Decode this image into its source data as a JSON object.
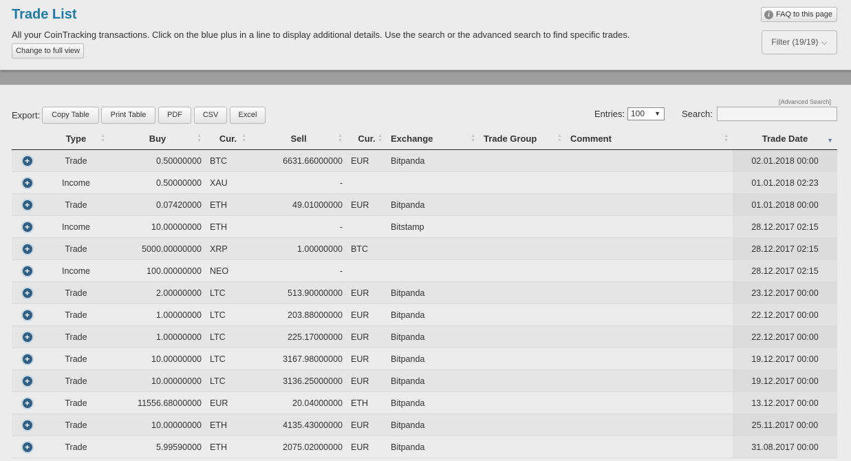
{
  "header": {
    "title": "Trade List",
    "subtitle": "All your CoinTracking transactions. Click on the blue plus in a line to display additional details. Use the search or the advanced search to find specific trades.",
    "full_view_label": "Change to full view",
    "faq_label": "FAQ to this page",
    "faq_icon_glyph": "i",
    "filter_label": "Filter (19/19)",
    "filter_chevron": "⌵"
  },
  "toolbar": {
    "advanced_search": "[Advanced Search]",
    "export_label": "Export:",
    "export_buttons": [
      "Copy Table",
      "Print Table",
      "PDF",
      "CSV",
      "Excel"
    ],
    "entries_label": "Entries:",
    "entries_value": "100",
    "search_label": "Search:",
    "search_value": ""
  },
  "table": {
    "columns": [
      "",
      "Type",
      "Buy",
      "Cur.",
      "Sell",
      "Cur.",
      "Exchange",
      "Trade Group",
      "Comment",
      "Trade Date"
    ],
    "sorted_column": "Trade Date",
    "sort_direction": "descending",
    "rows": [
      {
        "type": "Trade",
        "buy": "0.50000000",
        "buy_cur": "BTC",
        "sell": "6631.66000000",
        "sell_cur": "EUR",
        "exchange": "Bitpanda",
        "group": "",
        "comment": "",
        "date": "02.01.2018 00:00"
      },
      {
        "type": "Income",
        "buy": "0.50000000",
        "buy_cur": "XAU",
        "sell": "-",
        "sell_cur": "",
        "exchange": "",
        "group": "",
        "comment": "",
        "date": "01.01.2018 02:23"
      },
      {
        "type": "Trade",
        "buy": "0.07420000",
        "buy_cur": "ETH",
        "sell": "49.01000000",
        "sell_cur": "EUR",
        "exchange": "Bitpanda",
        "group": "",
        "comment": "",
        "date": "01.01.2018 00:00"
      },
      {
        "type": "Income",
        "buy": "10.00000000",
        "buy_cur": "ETH",
        "sell": "-",
        "sell_cur": "",
        "exchange": "Bitstamp",
        "group": "",
        "comment": "",
        "date": "28.12.2017 02:15"
      },
      {
        "type": "Trade",
        "buy": "5000.00000000",
        "buy_cur": "XRP",
        "sell": "1.00000000",
        "sell_cur": "BTC",
        "exchange": "",
        "group": "",
        "comment": "",
        "date": "28.12.2017 02:15"
      },
      {
        "type": "Income",
        "buy": "100.00000000",
        "buy_cur": "NEO",
        "sell": "-",
        "sell_cur": "",
        "exchange": "",
        "group": "",
        "comment": "",
        "date": "28.12.2017 02:15"
      },
      {
        "type": "Trade",
        "buy": "2.00000000",
        "buy_cur": "LTC",
        "sell": "513.90000000",
        "sell_cur": "EUR",
        "exchange": "Bitpanda",
        "group": "",
        "comment": "",
        "date": "23.12.2017 00:00"
      },
      {
        "type": "Trade",
        "buy": "1.00000000",
        "buy_cur": "LTC",
        "sell": "203.88000000",
        "sell_cur": "EUR",
        "exchange": "Bitpanda",
        "group": "",
        "comment": "",
        "date": "22.12.2017 00:00"
      },
      {
        "type": "Trade",
        "buy": "1.00000000",
        "buy_cur": "LTC",
        "sell": "225.17000000",
        "sell_cur": "EUR",
        "exchange": "Bitpanda",
        "group": "",
        "comment": "",
        "date": "22.12.2017 00:00"
      },
      {
        "type": "Trade",
        "buy": "10.00000000",
        "buy_cur": "LTC",
        "sell": "3167.98000000",
        "sell_cur": "EUR",
        "exchange": "Bitpanda",
        "group": "",
        "comment": "",
        "date": "19.12.2017 00:00"
      },
      {
        "type": "Trade",
        "buy": "10.00000000",
        "buy_cur": "LTC",
        "sell": "3136.25000000",
        "sell_cur": "EUR",
        "exchange": "Bitpanda",
        "group": "",
        "comment": "",
        "date": "19.12.2017 00:00"
      },
      {
        "type": "Trade",
        "buy": "11556.68000000",
        "buy_cur": "EUR",
        "sell": "20.04000000",
        "sell_cur": "ETH",
        "exchange": "Bitpanda",
        "group": "",
        "comment": "",
        "date": "13.12.2017 00:00"
      },
      {
        "type": "Trade",
        "buy": "10.00000000",
        "buy_cur": "ETH",
        "sell": "4135.43000000",
        "sell_cur": "EUR",
        "exchange": "Bitpanda",
        "group": "",
        "comment": "",
        "date": "25.11.2017 00:00"
      },
      {
        "type": "Trade",
        "buy": "5.99590000",
        "buy_cur": "ETH",
        "sell": "2075.02000000",
        "sell_cur": "EUR",
        "exchange": "Bitpanda",
        "group": "",
        "comment": "",
        "date": "31.08.2017 00:00"
      }
    ]
  },
  "colors": {
    "title": "#1e7aa8",
    "income": "#2a8a2a",
    "expand_icon": "#2e5f86"
  }
}
